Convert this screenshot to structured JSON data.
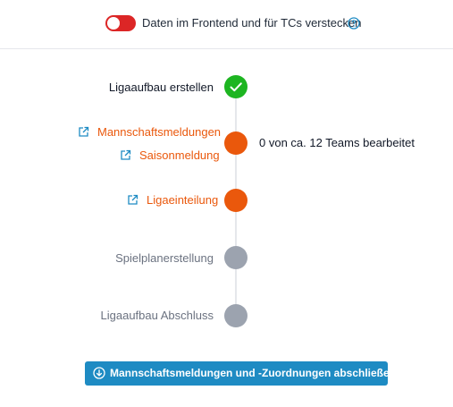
{
  "header": {
    "toggle_label": "Daten im Frontend und für TCs verstecken",
    "toggle_state": "off",
    "toggle_color": "#dc2626",
    "help_icon": "question-circle-icon"
  },
  "steps": [
    {
      "label": "Ligaaufbau erstellen",
      "status": "done",
      "icon": "check-icon"
    },
    {
      "links": [
        {
          "label": "Mannschaftsmeldungen",
          "icon": "external-link-icon"
        },
        {
          "label": "Saisonmeldung",
          "icon": "external-link-icon"
        }
      ],
      "status": "active",
      "status_text": "0 von ca. 12 Teams bearbeitet"
    },
    {
      "links": [
        {
          "label": "Ligaeinteilung",
          "icon": "external-link-icon"
        }
      ],
      "status": "active"
    },
    {
      "label": "Spielplanerstellung",
      "status": "pending"
    },
    {
      "label": "Ligaaufbau Abschluss",
      "status": "pending"
    }
  ],
  "action_button": {
    "label": "Mannschaftsmeldungen und -Zuordnungen abschließen",
    "icon": "arrow-down-circle-icon",
    "color": "#1e8bc3"
  },
  "colors": {
    "done": "#1db521",
    "active": "#ea580c",
    "pending": "#9ca3af",
    "link": "#ea580c",
    "icon_blue": "#1e8bc3"
  }
}
